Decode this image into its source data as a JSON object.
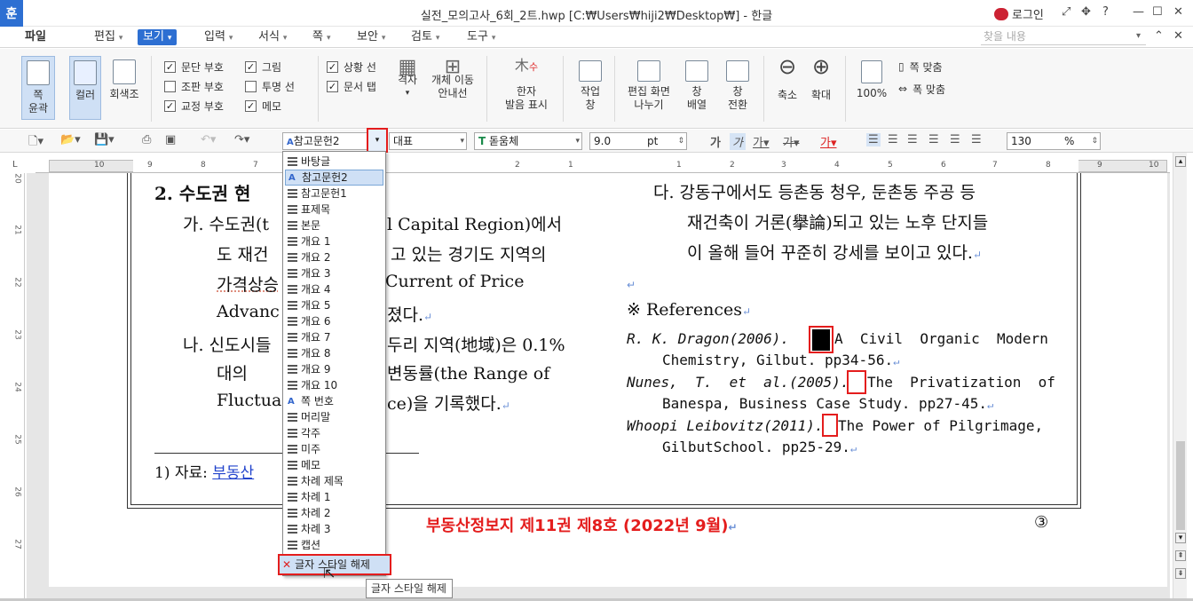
{
  "titlebar": {
    "app_icon": "훈",
    "title": "실전_모의고사_6회_2트.hwp [C:₩Users₩hiji2₩Desktop₩] - 한글",
    "login": "로그인"
  },
  "menubar": {
    "file": "파일",
    "items": [
      "편집",
      "보기",
      "입력",
      "서식",
      "쪽",
      "보안",
      "검토",
      "도구"
    ],
    "search_placeholder": "찾을 내용"
  },
  "ribbon": {
    "page_outline": "쪽\n윤곽",
    "color": "컬러",
    "grayscale": "회색조",
    "checks": [
      {
        "label": "문단 부호",
        "checked": true
      },
      {
        "label": "조판 부호",
        "checked": false
      },
      {
        "label": "교정 부호",
        "checked": true
      },
      {
        "label": "그림",
        "checked": true
      },
      {
        "label": "투명 선",
        "checked": false
      },
      {
        "label": "메모",
        "checked": true
      },
      {
        "label": "상황 선",
        "checked": true
      },
      {
        "label": "문서 탭",
        "checked": true
      }
    ],
    "grid": "격자",
    "object_guide": "개체 이동\n안내선",
    "hanja": "한자\n발음 표시",
    "task_pane": "작업\n창",
    "edit_split": "편집 화면\n나누기",
    "window_arrange": "창\n배열",
    "window_switch": "창\n전환",
    "zoom_out": "축소",
    "zoom_in": "확대",
    "zoom_100": "100%",
    "fit_page": "쪽 맞춤",
    "fit_width": "폭 맞춤"
  },
  "format_bar": {
    "style": "참고문헌2",
    "lang": "대표",
    "font": "돋움체",
    "size": "9.0",
    "size_unit": "pt",
    "zoom": "130",
    "zoom_unit": "%"
  },
  "style_dropdown": {
    "items": [
      "바탕글",
      "참고문헌2",
      "참고문헌1",
      "표제목",
      "본문",
      "개요 1",
      "개요 2",
      "개요 3",
      "개요 4",
      "개요 5",
      "개요 6",
      "개요 7",
      "개요 8",
      "개요 9",
      "개요 10",
      "쪽 번호",
      "머리말",
      "각주",
      "미주",
      "메모",
      "차례 제목",
      "차례 1",
      "차례 2",
      "차례 3",
      "캡션"
    ],
    "clear_style": "글자 스타일 해제",
    "selected_index": 1
  },
  "tooltip": "글자 스타일 해제",
  "document": {
    "left": {
      "heading": "2. 수도권 현",
      "ga_1": "가. 수도권(t",
      "ga_1b": "l Capital Region)에서",
      "ga_2": "도 재건",
      "ga_2b": "고 있는 경기도 지역의",
      "ga_3": "가격상승",
      "ga_3b": "Current    of    Price",
      "ga_4": "Advanc",
      "ga_4b": "졌다.",
      "na_1": "나. 신도시들",
      "na_1b": "두리 지역(地域)은 0.1%",
      "na_2": "대의   ",
      "na_2b": "변동률(the  Range  of",
      "na_3": "Fluctua",
      "na_3b": "ce)을 기록했다.",
      "footnote": "1) 자료: ",
      "footnote_link": "부동산"
    },
    "right": {
      "da_1": "다. 강동구에서도 등촌동 청우, 둔촌동 주공 등",
      "da_2": "재건축이 거론(擧論)되고 있는 노후 단지들",
      "da_3": "이 올해 들어 꾸준히 강세를 보이고 있다.",
      "refs_title": "※ References",
      "ref1_author": "R.   K.   Dragon(2006).",
      "ref1_rest": "A  Civil  Organic  Modern",
      "ref1_line2": "Chemistry, Gilbut. pp34-56.",
      "ref2_author": "Nunes,  T.  et  al.(2005).",
      "ref2_rest": "The  Privatization  of",
      "ref2_line2": "Banespa, Business Case Study. pp27-45.",
      "ref3_author": "Whoopi Leibovitz(2011).",
      "ref3_rest": "The Power of Pilgrimage,",
      "ref3_line2": "GilbutSchool. pp25-29."
    },
    "footer": "부동산정보지 제11권 제8호 (2022년 9월)",
    "page_number": "③"
  },
  "ruler_numbers": [
    "10",
    "9",
    "8",
    "7",
    "2",
    "1",
    "1",
    "2",
    "3",
    "4",
    "5",
    "6",
    "7",
    "8",
    "9",
    "10"
  ],
  "vruler_numbers": [
    "20",
    "21",
    "22",
    "23",
    "24",
    "25",
    "26",
    "27"
  ]
}
